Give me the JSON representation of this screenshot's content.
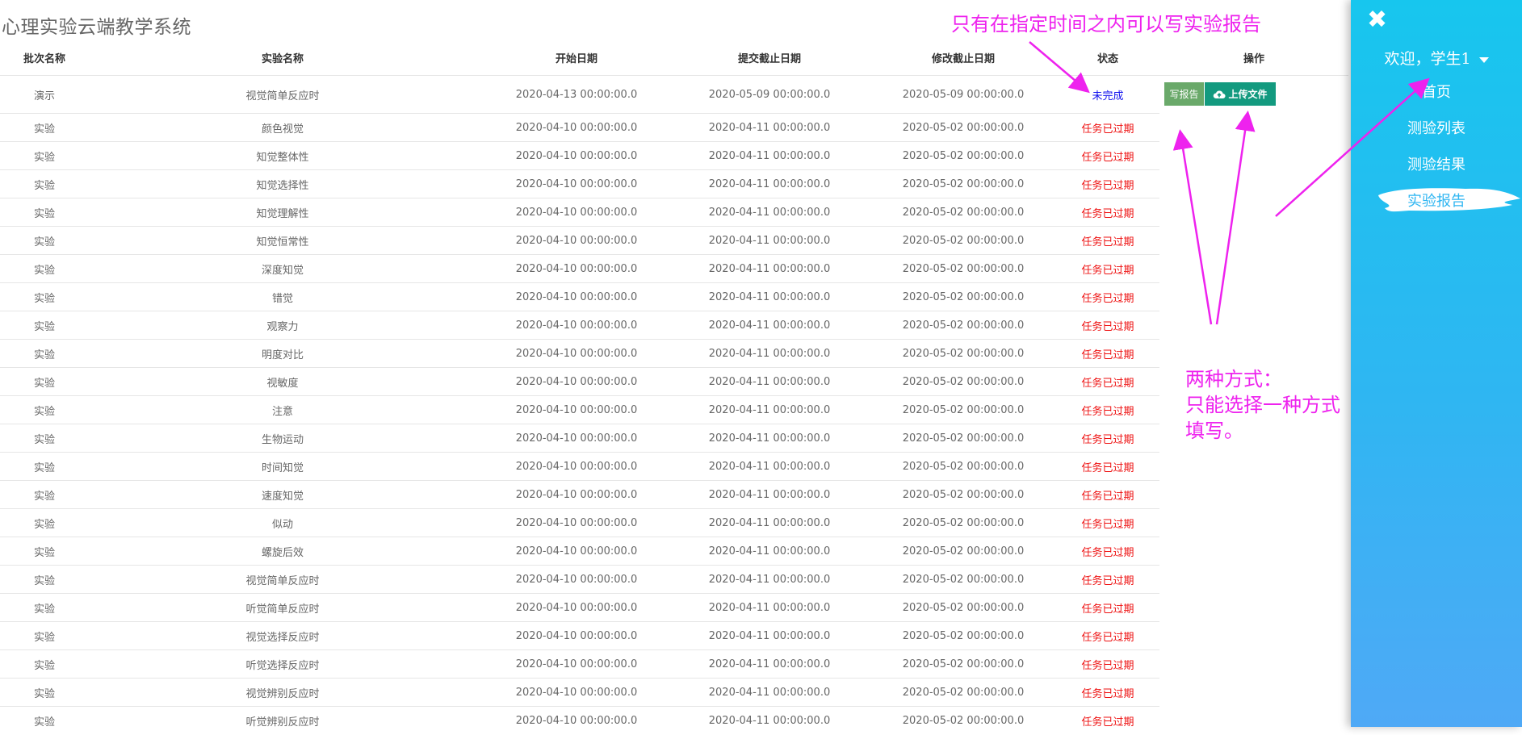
{
  "app": {
    "title": "心理实验云端教学系统"
  },
  "table": {
    "headers": {
      "batch": "批次名称",
      "name": "实验名称",
      "start": "开始日期",
      "submit": "提交截止日期",
      "modify": "修改截止日期",
      "status": "状态",
      "action": "操作"
    },
    "first_row": {
      "batch": "演示",
      "name": "视觉简单反应时",
      "start": "2020-04-13 00:00:00.0",
      "submit": "2020-05-09 00:00:00.0",
      "modify": "2020-05-09 00:00:00.0",
      "status": "未完成",
      "write_report_label": "写报告",
      "upload_file_label": "上传文件"
    },
    "rows": [
      {
        "batch": "实验",
        "name": "颜色视觉",
        "start": "2020-04-10 00:00:00.0",
        "submit": "2020-04-11 00:00:00.0",
        "modify": "2020-05-02 00:00:00.0",
        "status": "任务已过期"
      },
      {
        "batch": "实验",
        "name": "知觉整体性",
        "start": "2020-04-10 00:00:00.0",
        "submit": "2020-04-11 00:00:00.0",
        "modify": "2020-05-02 00:00:00.0",
        "status": "任务已过期"
      },
      {
        "batch": "实验",
        "name": "知觉选择性",
        "start": "2020-04-10 00:00:00.0",
        "submit": "2020-04-11 00:00:00.0",
        "modify": "2020-05-02 00:00:00.0",
        "status": "任务已过期"
      },
      {
        "batch": "实验",
        "name": "知觉理解性",
        "start": "2020-04-10 00:00:00.0",
        "submit": "2020-04-11 00:00:00.0",
        "modify": "2020-05-02 00:00:00.0",
        "status": "任务已过期"
      },
      {
        "batch": "实验",
        "name": "知觉恒常性",
        "start": "2020-04-10 00:00:00.0",
        "submit": "2020-04-11 00:00:00.0",
        "modify": "2020-05-02 00:00:00.0",
        "status": "任务已过期"
      },
      {
        "batch": "实验",
        "name": "深度知觉",
        "start": "2020-04-10 00:00:00.0",
        "submit": "2020-04-11 00:00:00.0",
        "modify": "2020-05-02 00:00:00.0",
        "status": "任务已过期"
      },
      {
        "batch": "实验",
        "name": "错觉",
        "start": "2020-04-10 00:00:00.0",
        "submit": "2020-04-11 00:00:00.0",
        "modify": "2020-05-02 00:00:00.0",
        "status": "任务已过期"
      },
      {
        "batch": "实验",
        "name": "观察力",
        "start": "2020-04-10 00:00:00.0",
        "submit": "2020-04-11 00:00:00.0",
        "modify": "2020-05-02 00:00:00.0",
        "status": "任务已过期"
      },
      {
        "batch": "实验",
        "name": "明度对比",
        "start": "2020-04-10 00:00:00.0",
        "submit": "2020-04-11 00:00:00.0",
        "modify": "2020-05-02 00:00:00.0",
        "status": "任务已过期"
      },
      {
        "batch": "实验",
        "name": "视敏度",
        "start": "2020-04-10 00:00:00.0",
        "submit": "2020-04-11 00:00:00.0",
        "modify": "2020-05-02 00:00:00.0",
        "status": "任务已过期"
      },
      {
        "batch": "实验",
        "name": "注意",
        "start": "2020-04-10 00:00:00.0",
        "submit": "2020-04-11 00:00:00.0",
        "modify": "2020-05-02 00:00:00.0",
        "status": "任务已过期"
      },
      {
        "batch": "实验",
        "name": "生物运动",
        "start": "2020-04-10 00:00:00.0",
        "submit": "2020-04-11 00:00:00.0",
        "modify": "2020-05-02 00:00:00.0",
        "status": "任务已过期"
      },
      {
        "batch": "实验",
        "name": "时间知觉",
        "start": "2020-04-10 00:00:00.0",
        "submit": "2020-04-11 00:00:00.0",
        "modify": "2020-05-02 00:00:00.0",
        "status": "任务已过期"
      },
      {
        "batch": "实验",
        "name": "速度知觉",
        "start": "2020-04-10 00:00:00.0",
        "submit": "2020-04-11 00:00:00.0",
        "modify": "2020-05-02 00:00:00.0",
        "status": "任务已过期"
      },
      {
        "batch": "实验",
        "name": "似动",
        "start": "2020-04-10 00:00:00.0",
        "submit": "2020-04-11 00:00:00.0",
        "modify": "2020-05-02 00:00:00.0",
        "status": "任务已过期"
      },
      {
        "batch": "实验",
        "name": "螺旋后效",
        "start": "2020-04-10 00:00:00.0",
        "submit": "2020-04-11 00:00:00.0",
        "modify": "2020-05-02 00:00:00.0",
        "status": "任务已过期"
      },
      {
        "batch": "实验",
        "name": "视觉简单反应时",
        "start": "2020-04-10 00:00:00.0",
        "submit": "2020-04-11 00:00:00.0",
        "modify": "2020-05-02 00:00:00.0",
        "status": "任务已过期"
      },
      {
        "batch": "实验",
        "name": "听觉简单反应时",
        "start": "2020-04-10 00:00:00.0",
        "submit": "2020-04-11 00:00:00.0",
        "modify": "2020-05-02 00:00:00.0",
        "status": "任务已过期"
      },
      {
        "batch": "实验",
        "name": "视觉选择反应时",
        "start": "2020-04-10 00:00:00.0",
        "submit": "2020-04-11 00:00:00.0",
        "modify": "2020-05-02 00:00:00.0",
        "status": "任务已过期"
      },
      {
        "batch": "实验",
        "name": "听觉选择反应时",
        "start": "2020-04-10 00:00:00.0",
        "submit": "2020-04-11 00:00:00.0",
        "modify": "2020-05-02 00:00:00.0",
        "status": "任务已过期"
      },
      {
        "batch": "实验",
        "name": "视觉辨别反应时",
        "start": "2020-04-10 00:00:00.0",
        "submit": "2020-04-11 00:00:00.0",
        "modify": "2020-05-02 00:00:00.0",
        "status": "任务已过期"
      },
      {
        "batch": "实验",
        "name": "听觉辨别反应时",
        "start": "2020-04-10 00:00:00.0",
        "submit": "2020-04-11 00:00:00.0",
        "modify": "2020-05-02 00:00:00.0",
        "status": "任务已过期"
      }
    ]
  },
  "sidebar": {
    "welcome": "欢迎，学生1",
    "items": [
      {
        "label": "首页"
      },
      {
        "label": "测验列表"
      },
      {
        "label": "测验结果"
      },
      {
        "label": "实验报告"
      }
    ],
    "active_index": 3
  },
  "annotations": {
    "top": "只有在指定时间之内可以写实验报告",
    "bottom_line1": "两种方式：",
    "bottom_line2": "只能选择一种方式",
    "bottom_line3": "填写。"
  },
  "colors": {
    "expired": "#ee1111",
    "pending": "#1111ee",
    "annotation": "#ee22ee",
    "sidebar": "#2fb6f2",
    "write_btn": "#6aa96a",
    "upload_btn": "#139a7f"
  }
}
